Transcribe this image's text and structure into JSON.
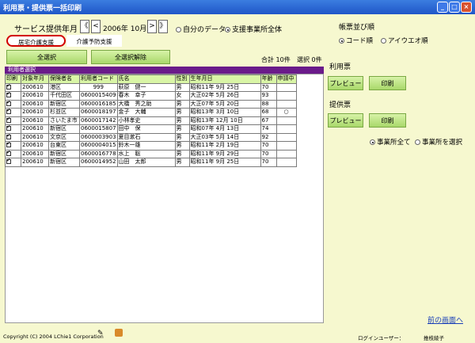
{
  "window": {
    "title": "利用票・提供票一括印刷"
  },
  "service_month": {
    "label": "サービス提供年月",
    "year_month": "2006年 10月",
    "prev_year": "《",
    "prev_month": "<",
    "next_month": ">",
    "next_year": "》"
  },
  "data_scope": {
    "own_label": "自分のデータ",
    "all_label": "支援事業所全体",
    "selected": "all"
  },
  "tabs": [
    {
      "label": "居宅介護支援",
      "active": true
    },
    {
      "label": "介護予防支援",
      "active": false
    }
  ],
  "buttons": {
    "select_all": "全選択",
    "deselect_all": "全選択解除"
  },
  "counts": {
    "total": "合計 10件",
    "selected": "選択 0件"
  },
  "list_title": "利用者選択",
  "columns": [
    "印刷",
    "対象年月",
    "保険者名",
    "利用者コード",
    "氏名",
    "性別",
    "生年月日",
    "年齢",
    "申請中"
  ],
  "rows": [
    [
      "✓",
      "200610",
      "港区",
      "999",
      "萩原　健一",
      "男",
      "昭和11年 9月 25日",
      "70",
      ""
    ],
    [
      "✓",
      "200610",
      "千代田区",
      "0600015409",
      "春木　幸子",
      "女",
      "大正02年 5月 26日",
      "93",
      ""
    ],
    [
      "✓",
      "200610",
      "新宿区",
      "0600016185",
      "大橋　秀之助",
      "男",
      "大正07年 5月 20日",
      "88",
      ""
    ],
    [
      "✓",
      "200610",
      "杉並区",
      "0600018197",
      "金子　大輔",
      "男",
      "昭和13年 3月 10日",
      "68",
      "○"
    ],
    [
      "✓",
      "200610",
      "さいたま市",
      "0600017142",
      "小林孝史",
      "男",
      "昭和13年 12月 10日",
      "67",
      ""
    ],
    [
      "✓",
      "200610",
      "新宿区",
      "0600015807",
      "田中　保",
      "男",
      "昭和07年 4月 13日",
      "74",
      ""
    ],
    [
      "✓",
      "200610",
      "文京区",
      "0600003903",
      "夏目漱石",
      "男",
      "大正03年 5月 14日",
      "92",
      ""
    ],
    [
      "✓",
      "200610",
      "台東区",
      "0600004015",
      "鈴木一雄",
      "男",
      "昭和11年 2月 19日",
      "70",
      ""
    ],
    [
      "✓",
      "200610",
      "新宿区",
      "0600016778",
      "水上　聡",
      "男",
      "昭和11年 9月 29日",
      "70",
      ""
    ],
    [
      "✓",
      "200610",
      "新宿区",
      "0600014952",
      "山田　太郎",
      "男",
      "昭和11年 9月 25日",
      "70",
      ""
    ]
  ],
  "sort": {
    "label": "帳票並び順",
    "code_label": "コード順",
    "kana_label": "アイウエオ順",
    "selected": "code"
  },
  "riyohyo": {
    "label": "利用票",
    "preview": "プレビュー",
    "print": "印刷"
  },
  "teikyohyo": {
    "label": "提供票",
    "preview": "プレビュー",
    "print": "印刷"
  },
  "office": {
    "all_label": "事業所全て",
    "select_label": "事業所を選択",
    "selected": "all"
  },
  "back_link": "前の画面へ",
  "footer": {
    "copyright": "Copyright (C) 2004 LChie1 Corporation",
    "login_label": "ログインユーザー：",
    "user": "推枝綾子"
  }
}
